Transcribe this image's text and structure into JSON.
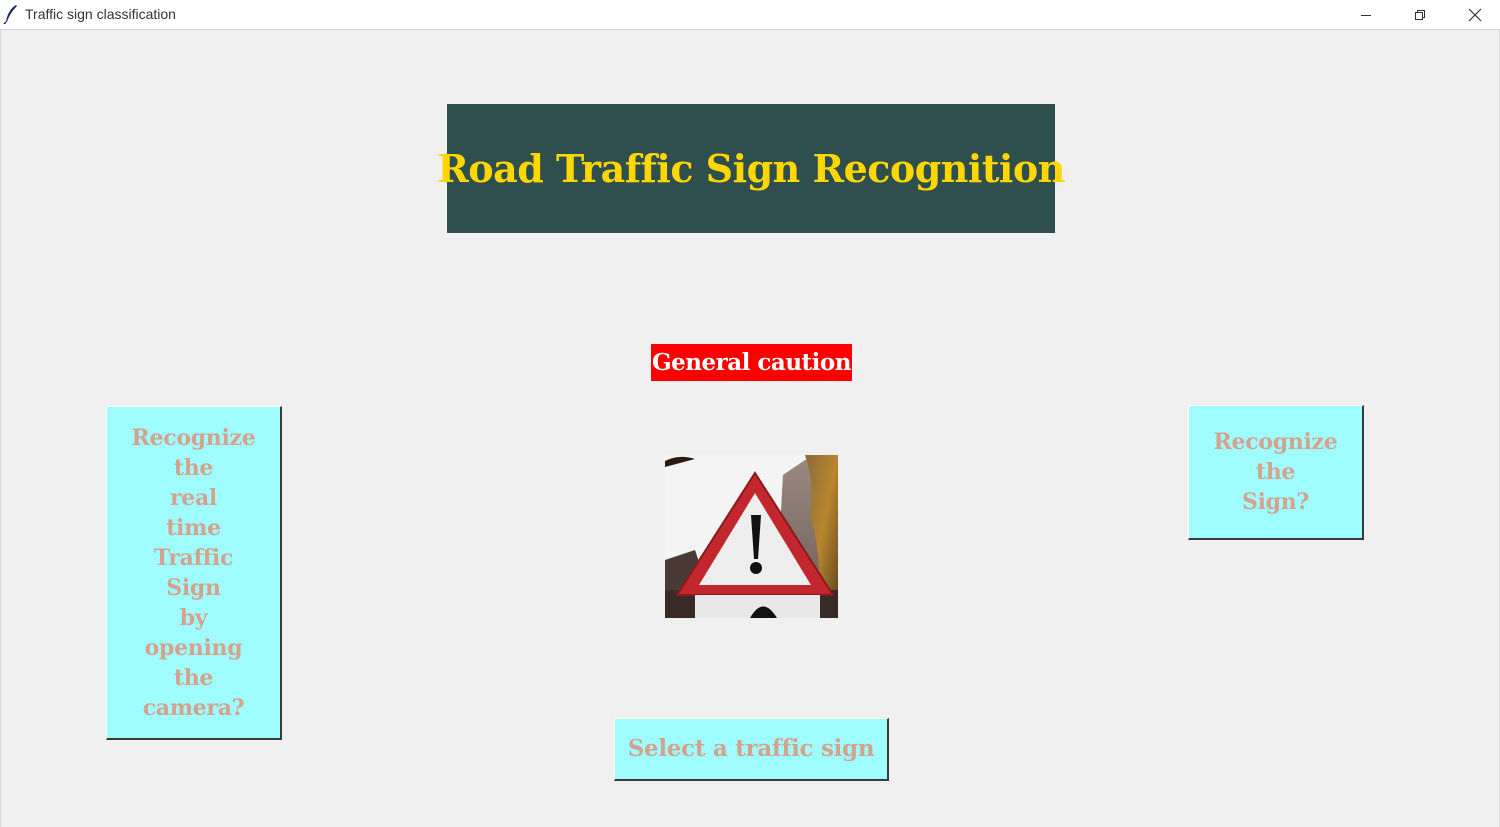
{
  "window": {
    "title": "Traffic sign classification",
    "icons": {
      "app": "feather-icon",
      "minimize": "minimize-icon",
      "restore": "restore-icon",
      "close": "close-icon"
    }
  },
  "heading": {
    "text": "Road Traffic Sign Recognition",
    "bg_color": "#2f4f4f",
    "text_color": "#ffd700"
  },
  "result": {
    "text": "General caution",
    "bg_color": "#ff0000",
    "text_color": "#ffffff"
  },
  "image": {
    "icon": "general-caution-sign-photo"
  },
  "buttons": {
    "camera_label": "Recognize\nthe\nreal\ntime\nTraffic\nSign\nby\nopening\nthe\ncamera?",
    "classify_label": "Recognize\nthe\nSign?",
    "upload_label": "Select a traffic sign",
    "bg_color": "#9ffcff",
    "text_color": "#d4a38d"
  }
}
